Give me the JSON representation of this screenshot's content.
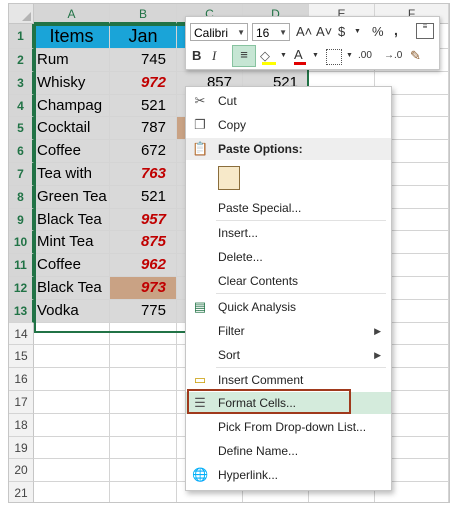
{
  "sheet": {
    "columns": [
      "A",
      "B",
      "C",
      "D",
      "E",
      "F"
    ],
    "rows": [
      "1",
      "2",
      "3",
      "4",
      "5",
      "6",
      "7",
      "8",
      "9",
      "10",
      "11",
      "12",
      "13",
      "14",
      "15",
      "16",
      "17",
      "18",
      "19",
      "20",
      "21"
    ],
    "header": {
      "items": "Items",
      "jan": "Jan"
    },
    "data": [
      {
        "item": "Rum",
        "val": "745"
      },
      {
        "item": "Whisky",
        "val": "972"
      },
      {
        "item": "Champag",
        "val": "521"
      },
      {
        "item": "Cocktail",
        "val": "787"
      },
      {
        "item": "Coffee",
        "val": "672"
      },
      {
        "item": "Tea with",
        "val": "763"
      },
      {
        "item": "Green Tea",
        "val": "521"
      },
      {
        "item": "Black Tea",
        "val": "957"
      },
      {
        "item": "Mint Tea",
        "val": "875"
      },
      {
        "item": "Coffee",
        "val": "962"
      },
      {
        "item": "Black Tea",
        "val": "973"
      },
      {
        "item": "Vodka",
        "val": "775"
      }
    ],
    "partial_c3": "857",
    "partial_d3": "521"
  },
  "toolbar": {
    "font": "Calibri",
    "size": "16",
    "grow": "A˄",
    "shrink": "A˅",
    "currency": "$",
    "percent": "%",
    "comma": ",",
    "bold": "B",
    "italic": "I",
    "font_color": "A",
    "decimals": ".00"
  },
  "menu": {
    "cut": "Cut",
    "copy": "Copy",
    "paste_options": "Paste Options:",
    "paste_special": "Paste Special...",
    "insert": "Insert...",
    "delete": "Delete...",
    "clear": "Clear Contents",
    "quick": "Quick Analysis",
    "filter": "Filter",
    "sort": "Sort",
    "comment": "Insert Comment",
    "format": "Format Cells...",
    "pick": "Pick From Drop-down List...",
    "define": "Define Name...",
    "hyperlink": "Hyperlink..."
  }
}
